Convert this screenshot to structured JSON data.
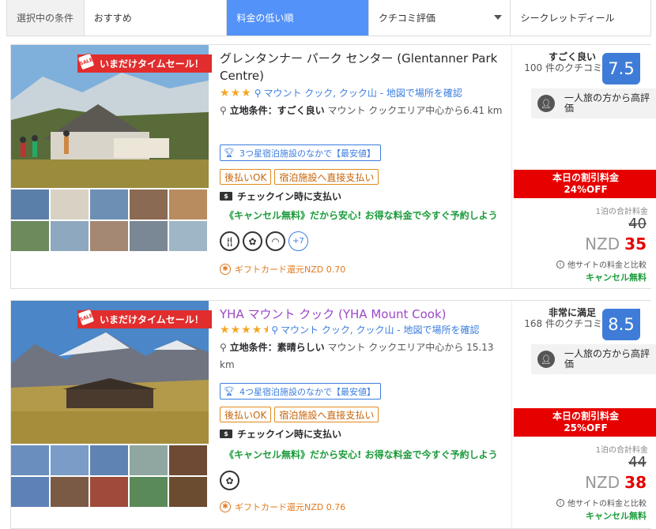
{
  "sortbar": {
    "label": "選択中の条件",
    "options": [
      "おすすめ",
      "料金の低い順",
      "クチコミ評価",
      "シークレットディール"
    ],
    "active_index": 1
  },
  "colors": {
    "accent": "#5392f9",
    "score": "#3e7cd8",
    "sale": "#e12d2d",
    "discount": "#e60000",
    "green": "#1c9b3b",
    "orange": "#e07a1e"
  },
  "sale_ribbon": "いまだけタイムセール！",
  "hotels": [
    {
      "name": "グレンタンナー パーク センター (Glentanner Park Centre)",
      "stars": 3,
      "location": "マウント クック, クック山 - 地図で場所を確認",
      "loc_label": "立地条件：すごく良い",
      "loc_text": "マウント クックエリア中心から6.41 km",
      "rank_badge": "3つ星宿泊施設のなかで【最安値】",
      "pay_badges": [
        "後払いOK",
        "宿泊施設へ直接支払い"
      ],
      "checkin_pay": "チェックイン時に支払い",
      "cancel_msg": "《キャンセル無料》だから安心! お得な料金で今すぐ予約しよう",
      "amenity_icons": [
        "restaurant-icon",
        "spa-icon",
        "wifi-icon"
      ],
      "amenity_more": "+7",
      "gift": "ギフトカード還元NZD 0.70",
      "review_word": "すごく良い",
      "review_count": "100 件のクチコミ",
      "score": "7.5",
      "solo": "一人旅の方から高評価",
      "discount": "本日の割引料金\n24%OFF",
      "discount_l1": "本日の割引料金",
      "discount_l2": "24%OFF",
      "total_label": "1泊の合計料金",
      "original_price": "40",
      "currency": "NZD",
      "price": "35",
      "compare": "他サイトの料金と比較",
      "free_cancel": "キャンセル無料"
    },
    {
      "name": "YHA マウント クック (YHA Mount Cook)",
      "stars": 4.5,
      "location": "マウント クック, クック山 - 地図で場所を確認",
      "loc_label": "立地条件：素晴らしい",
      "loc_text": "マウント クックエリア中心から 15.13 km",
      "rank_badge": "4つ星宿泊施設のなかで【最安値】",
      "pay_badges": [
        "後払いOK",
        "宿泊施設へ直接支払い"
      ],
      "checkin_pay": "チェックイン時に支払い",
      "cancel_msg": "《キャンセル無料》だから安心! お得な料金で今すぐ予約しよう",
      "amenity_icons": [
        "spa-icon"
      ],
      "amenity_more": "",
      "gift": "ギフトカード還元NZD 0.76",
      "review_word": "非常に満足",
      "review_count": "168 件のクチコミ",
      "score": "8.5",
      "solo": "一人旅の方から高評価",
      "discount_l1": "本日の割引料金",
      "discount_l2": "25%OFF",
      "total_label": "1泊の合計料金",
      "original_price": "44",
      "currency": "NZD",
      "price": "38",
      "compare": "他サイトの料金と比較",
      "free_cancel": "キャンセル無料"
    }
  ]
}
